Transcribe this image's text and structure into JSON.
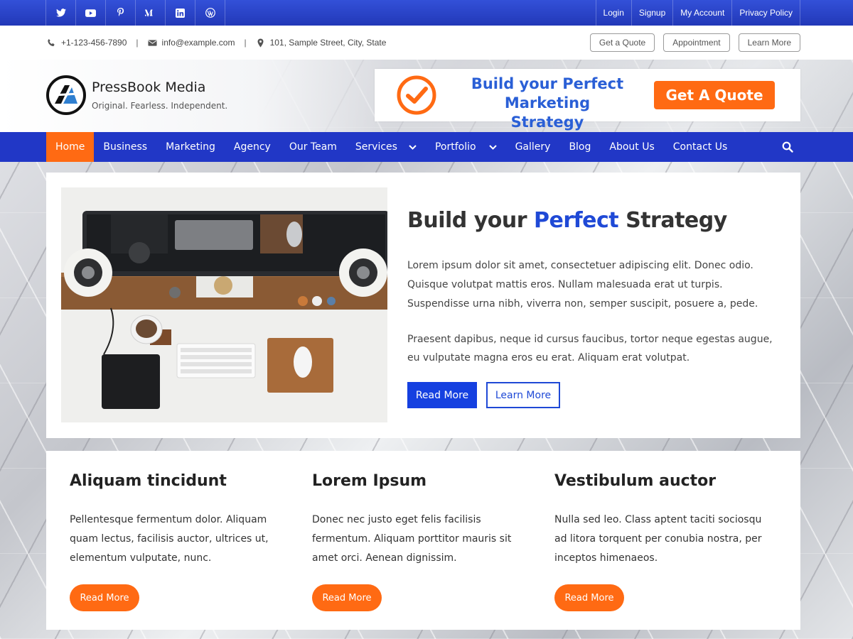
{
  "topbar": {
    "social": [
      {
        "name": "twitter-icon",
        "glyph": "🐦"
      },
      {
        "name": "youtube-icon",
        "glyph": "▶"
      },
      {
        "name": "pinterest-icon",
        "glyph": "P"
      },
      {
        "name": "medium-icon",
        "glyph": "M"
      },
      {
        "name": "linkedin-icon",
        "glyph": "in"
      },
      {
        "name": "wordpress-icon",
        "glyph": "W"
      }
    ],
    "links": [
      "Login",
      "Signup",
      "My Account",
      "Privacy Policy"
    ]
  },
  "contact": {
    "phone": "+1-123-456-7890",
    "email": "info@example.com",
    "address": "101, Sample Street, City, State",
    "buttons": [
      "Get a Quote",
      "Appointment",
      "Learn More"
    ]
  },
  "header": {
    "brand": "PressBook Media",
    "tagline": "Original. Fearless. Independent.",
    "banner_line1": "Build your Perfect",
    "banner_line2": "Marketing Strategy",
    "banner_cta": "Get A Quote"
  },
  "nav": {
    "items": [
      "Home",
      "Business",
      "Marketing",
      "Agency",
      "Our Team",
      "Services",
      "Portfolio",
      "Gallery",
      "Blog",
      "About Us",
      "Contact Us"
    ]
  },
  "hero": {
    "title_before": "Build your ",
    "title_highlight": "Perfect",
    "title_after": " Strategy",
    "para1": "Lorem ipsum dolor sit amet, consectetuer adipiscing elit. Donec odio. Quisque volutpat mattis eros. Nullam malesuada erat ut turpis. Suspendisse urna nibh, viverra non, semper suscipit, posuere a, pede.",
    "para2": "Praesent dapibus, neque id cursus faucibus, tortor neque egestas augue, eu vulputate magna eros eu erat. Aliquam erat volutpat.",
    "btn_primary": "Read More",
    "btn_secondary": "Learn More"
  },
  "features": [
    {
      "title": "Aliquam tincidunt",
      "text": "Pellentesque fermentum dolor. Aliquam quam lectus, facilisis auctor, ultrices ut, elementum vulputate, nunc.",
      "button": "Read More"
    },
    {
      "title": "Lorem Ipsum",
      "text": "Donec nec justo eget felis facilisis fermentum. Aliquam porttitor mauris sit amet orci. Aenean dignissim.",
      "button": "Read More"
    },
    {
      "title": "Vestibulum auctor",
      "text": "Nulla sed leo. Class aptent taciti sociosqu ad litora torquent per conubia nostra, per inceptos himenaeos.",
      "button": "Read More"
    }
  ],
  "colors": {
    "primary_blue": "#2137c6",
    "accent_orange": "#ff6a13",
    "link_blue": "#1f49d6"
  }
}
